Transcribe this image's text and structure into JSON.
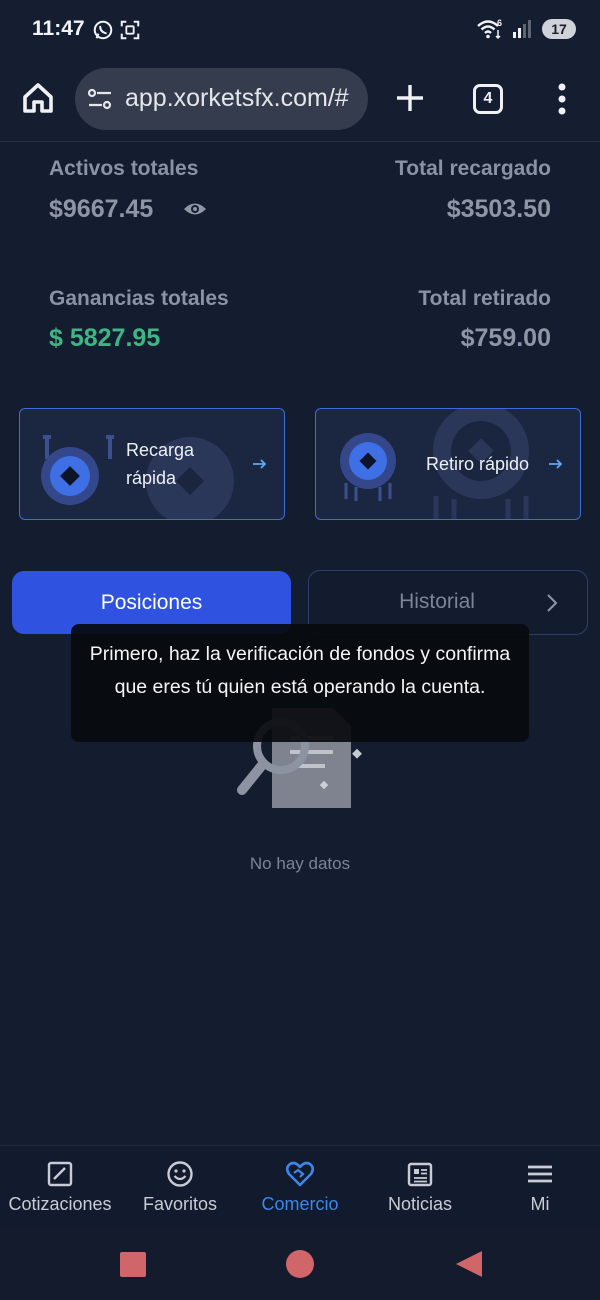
{
  "status_bar": {
    "time": "11:47",
    "battery": "17",
    "network_badge": "6"
  },
  "browser": {
    "url": "app.xorketsfx.com/#",
    "tab_count": "4"
  },
  "summary": {
    "total_assets_label": "Activos totales",
    "total_assets_value": "$9667.45",
    "total_deposited_label": "Total recargado",
    "total_deposited_value": "$3503.50",
    "total_profit_label": "Ganancias totales",
    "total_profit_value": "$ 5827.95",
    "total_withdrawn_label": "Total retirado",
    "total_withdrawn_value": "$759.00"
  },
  "quick_actions": {
    "deposit_line1": "Recarga",
    "deposit_line2": "rápida",
    "withdraw_label": "Retiro rápido"
  },
  "tabs": {
    "positions": "Posiciones",
    "history": "Historial"
  },
  "toast": {
    "message": "Primero, haz la verificación de fondos y confirma que eres tú quien está operando la cuenta."
  },
  "empty_state": {
    "text": "No hay datos"
  },
  "bottom_nav": {
    "items": [
      {
        "label": "Cotizaciones",
        "icon": "chart-box-icon"
      },
      {
        "label": "Favoritos",
        "icon": "smiley-icon"
      },
      {
        "label": "Comercio",
        "icon": "handshake-heart-icon"
      },
      {
        "label": "Noticias",
        "icon": "newspaper-icon"
      },
      {
        "label": "Mi",
        "icon": "menu-lines-icon"
      }
    ],
    "active": "Comercio"
  },
  "colors": {
    "background": "#141c30",
    "accent_blue": "#2f53e0",
    "profit_green": "#3fb583",
    "active_nav": "#3d86ea"
  }
}
